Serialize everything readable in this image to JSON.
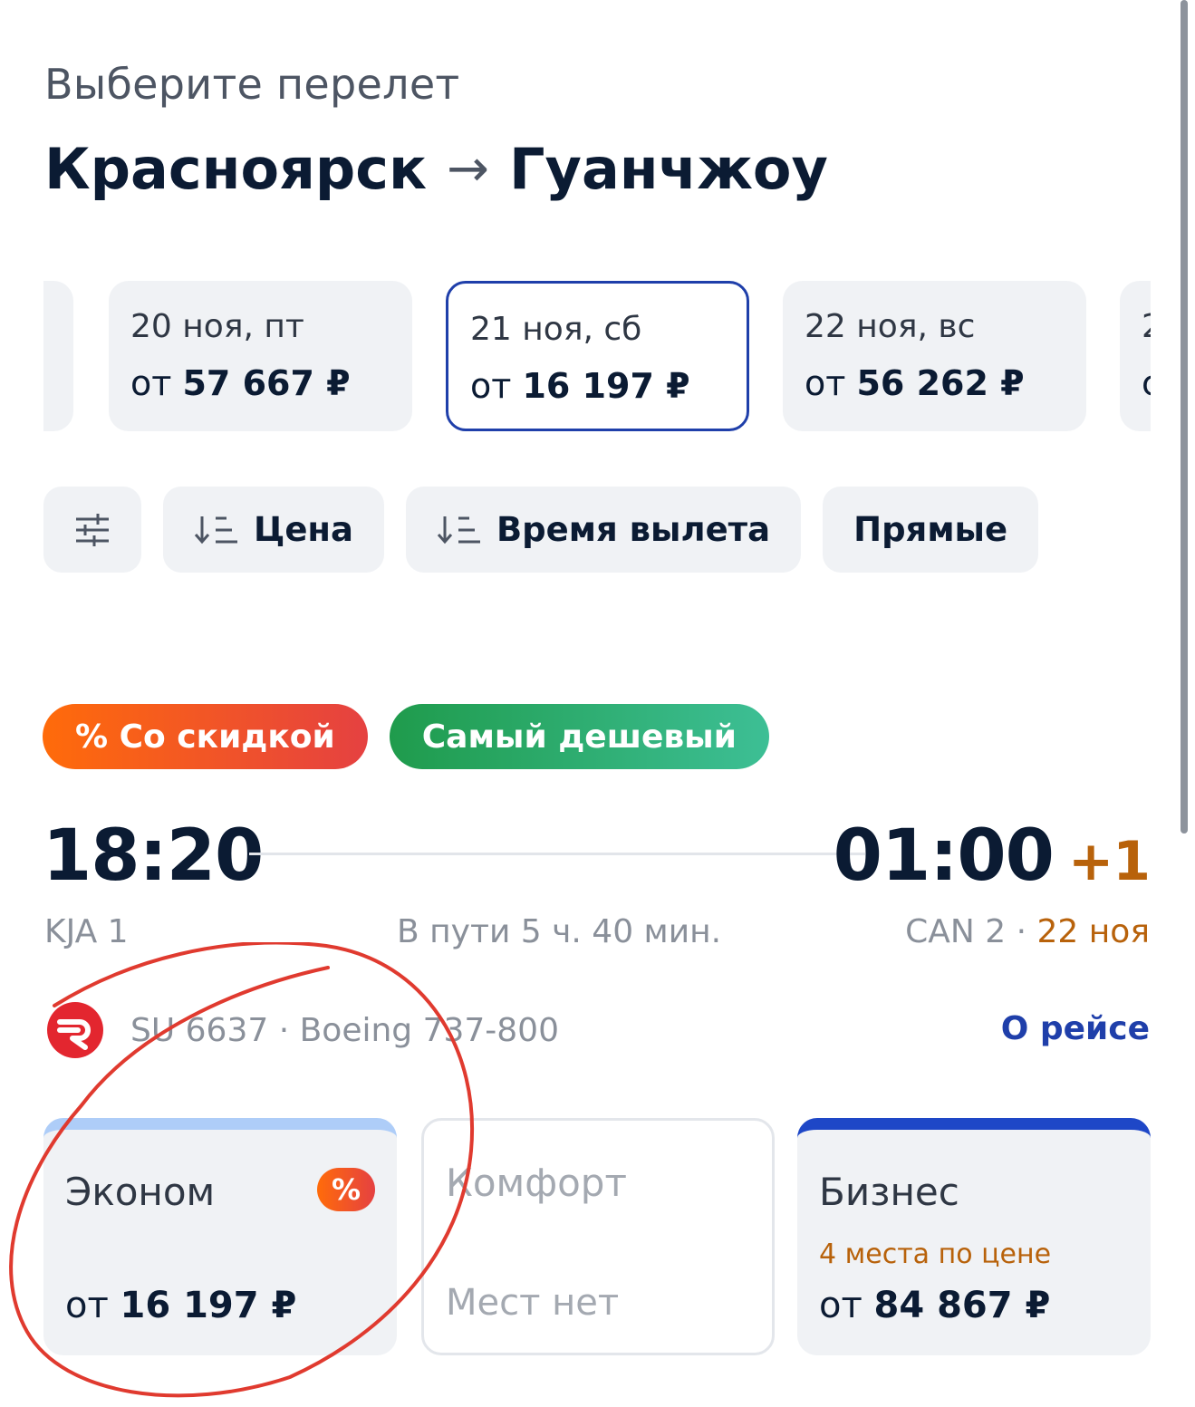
{
  "header": {
    "subtitle": "Выберите перелет",
    "origin": "Красноярск",
    "arrow": "→",
    "destination": "Гуанчжоу"
  },
  "dates": [
    {
      "label": "",
      "price_prefix": "",
      "price": ""
    },
    {
      "label": "20 ноя, пт",
      "price_prefix": "от",
      "price": "57 667 ₽"
    },
    {
      "label": "21 ноя, сб",
      "price_prefix": "от",
      "price": "16 197 ₽",
      "selected": true
    },
    {
      "label": "22 ноя, вс",
      "price_prefix": "от",
      "price": "56 262 ₽"
    },
    {
      "label": "2",
      "price_prefix": "с",
      "price": ""
    }
  ],
  "filters": {
    "price": "Цена",
    "departure_time": "Время вылета",
    "direct": "Прямые"
  },
  "badges": {
    "discount": "% Со скидкой",
    "cheapest": "Самый дешевый"
  },
  "flight": {
    "departure_time": "18:20",
    "arrival_time": "01:00",
    "day_offset": "+1",
    "departure_airport": "KJA 1",
    "duration": "В пути 5 ч. 40 мин.",
    "arrival_airport": "CAN 2 ·",
    "arrival_date": "22 ноя",
    "flight_info": "SU 6637 · Boeing 737-800",
    "about_link": "О рейсе"
  },
  "fares": {
    "economy": {
      "name": "Эконом",
      "badge": "%",
      "price_prefix": "от",
      "price": "16 197 ₽"
    },
    "comfort": {
      "name": "Комфорт",
      "status": "Мест нет"
    },
    "business": {
      "name": "Бизнес",
      "seats": "4 места по цене",
      "price_prefix": "от",
      "price": "84 867 ₽"
    }
  },
  "colors": {
    "primary_text": "#0b1b33",
    "accent_blue": "#1f3faa",
    "accent_orange": "#b8620b",
    "annotation_red": "#e03a2f"
  }
}
